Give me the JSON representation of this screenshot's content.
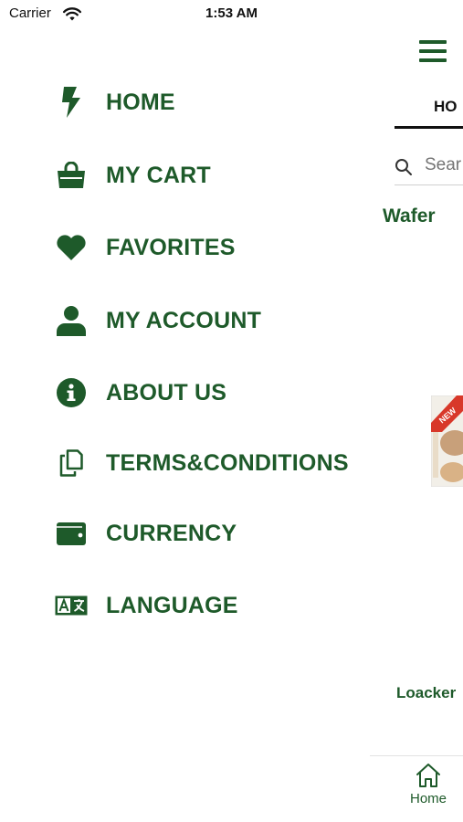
{
  "status_bar": {
    "carrier": "Carrier",
    "time": "1:53 AM",
    "wifi_icon": "wifi-icon",
    "battery_icon": "battery-icon"
  },
  "colors": {
    "brand_green": "#1e5a2a",
    "text_dark": "#111111",
    "background": "#ffffff"
  },
  "menu": {
    "items": [
      {
        "label": "HOME",
        "icon": "bolt-icon"
      },
      {
        "label": "MY CART",
        "icon": "shopping-bag-icon"
      },
      {
        "label": "FAVORITES",
        "icon": "heart-icon"
      },
      {
        "label": "MY ACCOUNT",
        "icon": "user-icon"
      },
      {
        "label": "ABOUT US",
        "icon": "info-icon"
      },
      {
        "label": "TERMS&CONDITIONS",
        "icon": "copy-icon"
      },
      {
        "label": "CURRENCY",
        "icon": "wallet-icon"
      },
      {
        "label": "LANGUAGE",
        "icon": "language-icon"
      }
    ]
  },
  "main": {
    "menu_button_icon": "hamburger-icon",
    "active_tab_label": "HO",
    "search": {
      "placeholder": "Sear",
      "icon": "search-icon"
    },
    "category_title": "Wafer",
    "product": {
      "name": "Loacker",
      "badge": "NEW"
    },
    "bottom_tab": {
      "label": "Home",
      "icon": "home-icon"
    }
  }
}
